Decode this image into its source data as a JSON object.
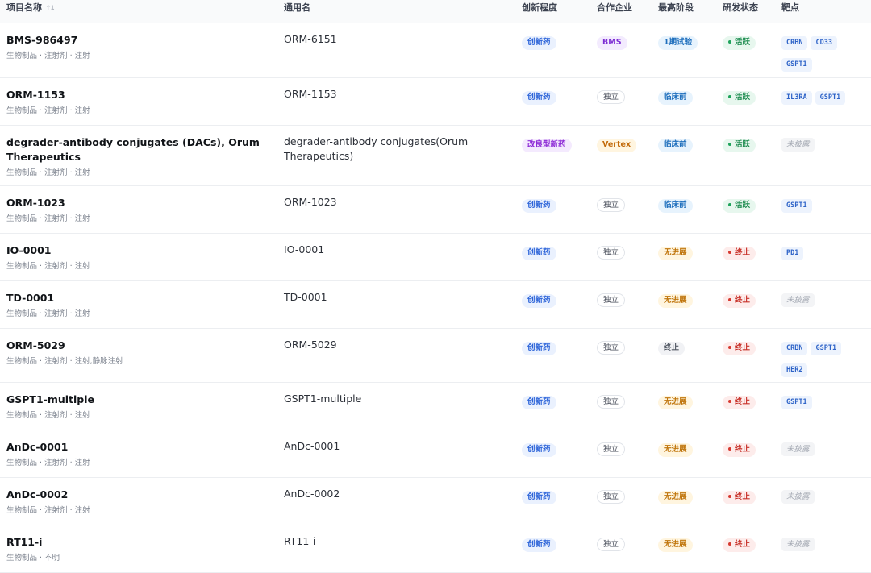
{
  "columns": {
    "name": "项目名称",
    "generic": "通用名",
    "innovation": "创新程度",
    "partner": "合作企业",
    "phase": "最高阶段",
    "status": "研发状态",
    "targets": "靶点"
  },
  "sort_icon": "sort-icon",
  "rows": [
    {
      "name": "BMS-986497",
      "sub": "生物制品 · 注射剂 · 注射",
      "generic": "ORM-6151",
      "innovation": "创新药",
      "partner": "BMS",
      "phase": "1期试验",
      "status": "活跃",
      "targets": [
        "CRBN",
        "CD33",
        "GSPT1"
      ]
    },
    {
      "name": "ORM-1153",
      "sub": "生物制品 · 注射剂 · 注射",
      "generic": "ORM-1153",
      "innovation": "创新药",
      "partner": "独立",
      "phase": "临床前",
      "status": "活跃",
      "targets": [
        "IL3RA",
        "GSPT1"
      ]
    },
    {
      "name": "degrader-antibody conjugates (DACs), Orum Therapeutics",
      "sub": "生物制品 · 注射剂 · 注射",
      "generic": "degrader-antibody conjugates(Orum Therapeutics)",
      "innovation": "改良型新药",
      "partner": "Vertex",
      "phase": "临床前",
      "status": "活跃",
      "targets": [],
      "targets_empty": "未披露"
    },
    {
      "name": "ORM-1023",
      "sub": "生物制品 · 注射剂 · 注射",
      "generic": "ORM-1023",
      "innovation": "创新药",
      "partner": "独立",
      "phase": "临床前",
      "status": "活跃",
      "targets": [
        "GSPT1"
      ]
    },
    {
      "name": "IO-0001",
      "sub": "生物制品 · 注射剂 · 注射",
      "generic": "IO-0001",
      "innovation": "创新药",
      "partner": "独立",
      "phase": "无进展",
      "status": "终止",
      "targets": [
        "PD1"
      ]
    },
    {
      "name": "TD-0001",
      "sub": "生物制品 · 注射剂 · 注射",
      "generic": "TD-0001",
      "innovation": "创新药",
      "partner": "独立",
      "phase": "无进展",
      "status": "终止",
      "targets": [],
      "targets_empty": "未披露"
    },
    {
      "name": "ORM-5029",
      "sub": "生物制品 · 注射剂 · 注射,静脉注射",
      "generic": "ORM-5029",
      "innovation": "创新药",
      "partner": "独立",
      "phase": "终止",
      "status": "终止",
      "targets": [
        "CRBN",
        "GSPT1",
        "HER2"
      ]
    },
    {
      "name": "GSPT1-multiple",
      "sub": "生物制品 · 注射剂 · 注射",
      "generic": "GSPT1-multiple",
      "innovation": "创新药",
      "partner": "独立",
      "phase": "无进展",
      "status": "终止",
      "targets": [
        "GSPT1"
      ]
    },
    {
      "name": "AnDc-0001",
      "sub": "生物制品 · 注射剂 · 注射",
      "generic": "AnDc-0001",
      "innovation": "创新药",
      "partner": "独立",
      "phase": "无进展",
      "status": "终止",
      "targets": [],
      "targets_empty": "未披露"
    },
    {
      "name": "AnDc-0002",
      "sub": "生物制品 · 注射剂 · 注射",
      "generic": "AnDc-0002",
      "innovation": "创新药",
      "partner": "独立",
      "phase": "无进展",
      "status": "终止",
      "targets": [],
      "targets_empty": "未披露"
    },
    {
      "name": "RT11-i",
      "sub": "生物制品 · 不明",
      "generic": "RT11-i",
      "innovation": "创新药",
      "partner": "独立",
      "phase": "无进展",
      "status": "终止",
      "targets": [],
      "targets_empty": "未披露"
    }
  ]
}
